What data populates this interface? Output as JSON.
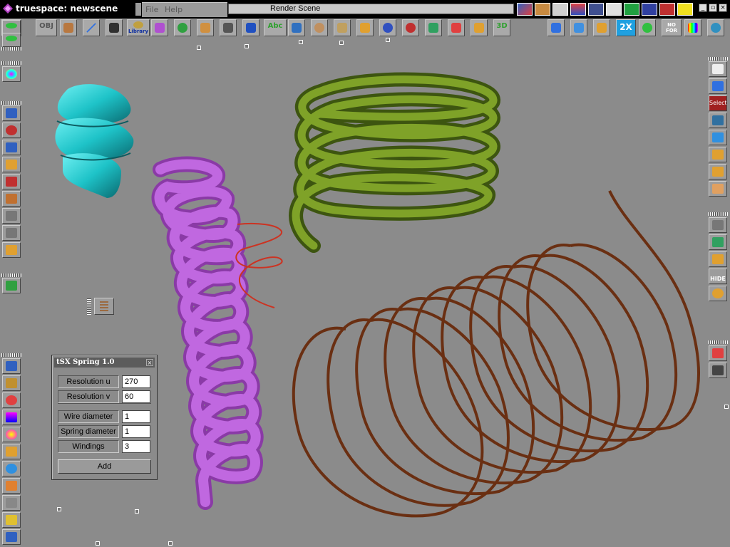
{
  "titlebar": {
    "title": "truespace: newscene"
  },
  "menu": {
    "items": [
      "File",
      "Help"
    ]
  },
  "status": {
    "text": "Render Scene"
  },
  "toolbar": {
    "obj_label": "OBJ",
    "library_label": "Library",
    "abc_label": "Abc",
    "threed_label": "3D",
    "twox_label": "2X",
    "nofor_label": "NO FOR"
  },
  "right_panel": {
    "select_label": "Select",
    "hide_label": "HIDE"
  },
  "spring_panel": {
    "title": "tSX Spring 1.0",
    "fields": [
      {
        "label": "Resolution u",
        "value": "270"
      },
      {
        "label": "Resolution v",
        "value": "60"
      },
      {
        "label": "Wire diameter",
        "value": "1"
      },
      {
        "label": "Spring diameter",
        "value": "1"
      },
      {
        "label": "Windings",
        "value": "3"
      }
    ],
    "add_label": "Add"
  },
  "scene": {
    "objects": [
      "cyan-spring",
      "purple-spring",
      "red-wire-spring",
      "green-spring",
      "brown-spring"
    ],
    "colors": {
      "cyan": "#1ec3c8",
      "purple": "#b050d0",
      "red": "#cc3322",
      "green": "#5a7a18",
      "brown": "#7a3a1a",
      "background": "#8b8b8b"
    }
  }
}
